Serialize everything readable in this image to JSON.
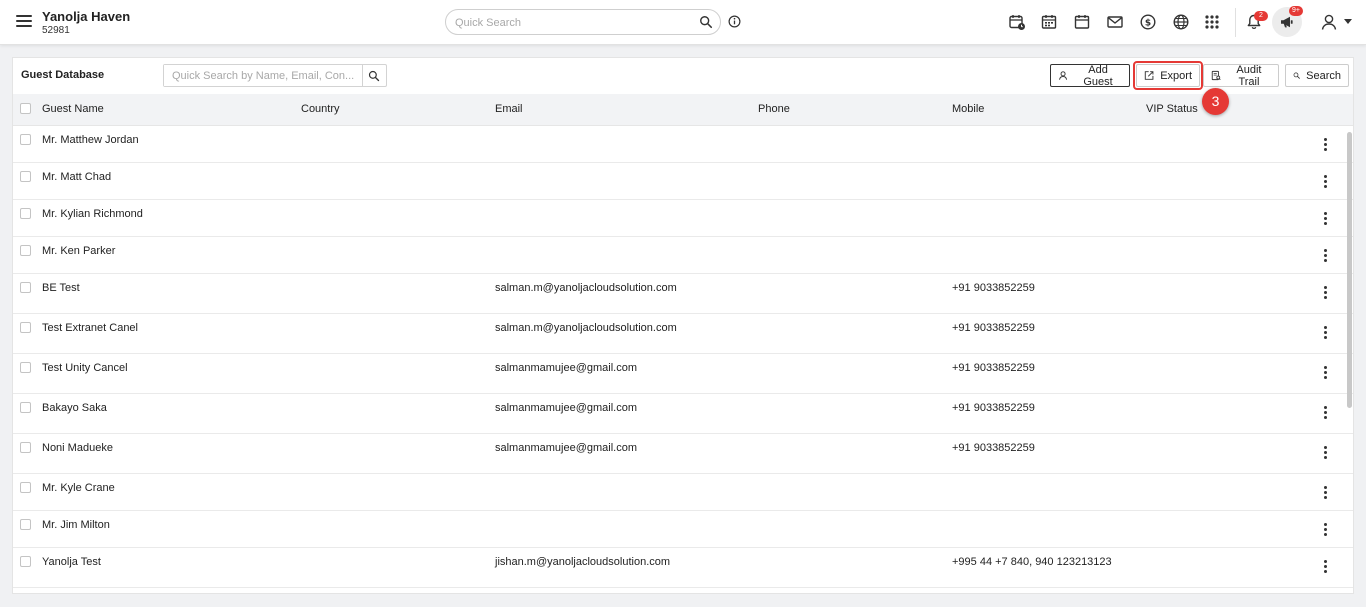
{
  "header": {
    "hotel_name": "Yanolja Haven",
    "hotel_id": "52981",
    "quick_search_placeholder": "Quick Search",
    "notification_count": "2",
    "announcement_count": "9+"
  },
  "guest_db": {
    "title": "Guest Database",
    "search_placeholder": "Quick Search by Name, Email, Con...",
    "buttons": {
      "add_guest": "Add Guest",
      "export": "Export",
      "audit_trail": "Audit Trail",
      "search": "Search"
    },
    "step_number": "3",
    "columns": {
      "guest_name": "Guest Name",
      "country": "Country",
      "email": "Email",
      "phone": "Phone",
      "mobile": "Mobile",
      "vip_status": "VIP Status"
    },
    "rows": [
      {
        "name": "Mr. Matthew Jordan",
        "email": "",
        "mobile": ""
      },
      {
        "name": "Mr. Matt Chad",
        "email": "",
        "mobile": ""
      },
      {
        "name": "Mr. Kylian Richmond",
        "email": "",
        "mobile": ""
      },
      {
        "name": "Mr. Ken Parker",
        "email": "",
        "mobile": ""
      },
      {
        "name": "BE Test",
        "email": "salman.m@yanoljacloudsolution.com",
        "mobile": "+91 9033852259"
      },
      {
        "name": "Test Extranet Canel",
        "email": "salman.m@yanoljacloudsolution.com",
        "mobile": "+91 9033852259"
      },
      {
        "name": "Test Unity Cancel",
        "email": "salmanmamujee@gmail.com",
        "mobile": "+91 9033852259"
      },
      {
        "name": "Bakayo Saka",
        "email": "salmanmamujee@gmail.com",
        "mobile": "+91 9033852259"
      },
      {
        "name": "Noni Madueke",
        "email": "salmanmamujee@gmail.com",
        "mobile": "+91 9033852259"
      },
      {
        "name": "Mr. Kyle Crane",
        "email": "",
        "mobile": ""
      },
      {
        "name": "Mr. Jim Milton",
        "email": "",
        "mobile": ""
      },
      {
        "name": "Yanolja Test",
        "email": "jishan.m@yanoljacloudsolution.com",
        "mobile": "+995 44 +7 840, 940 123213123"
      }
    ]
  },
  "colors": {
    "highlight": "#e53935",
    "header_bg": "#f2f3f5"
  }
}
